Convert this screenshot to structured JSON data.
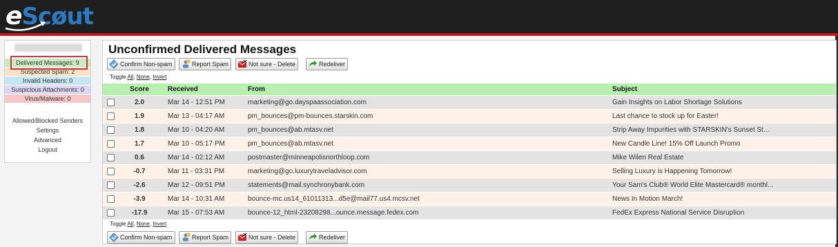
{
  "app": {
    "logo_text": "eScout"
  },
  "sidebar": {
    "folders": [
      {
        "label": "Delivered Messages: 9"
      },
      {
        "label": "Suspected Spam: 2"
      },
      {
        "label": "Invalid Headers: 0"
      },
      {
        "label": "Suspicious Attachments: 0"
      },
      {
        "label": "Virus/Malware: 0"
      }
    ],
    "links": [
      {
        "label": "Allowed/Blocked Senders"
      },
      {
        "label": "Settings"
      },
      {
        "label": "Advanced"
      },
      {
        "label": "Logout"
      }
    ]
  },
  "main": {
    "title": "Unconfirmed Delivered Messages",
    "buttons": {
      "confirm": "Confirm Non-spam",
      "report": "Report Spam",
      "delete": "Not sure - Delete",
      "redeliver": "Redeliver"
    },
    "toggle": {
      "prefix": "Toggle",
      "all": "All",
      "none": "None",
      "invert": "Invert"
    },
    "columns": {
      "score": "Score",
      "received": "Received",
      "from": "From",
      "subject": "Subject"
    },
    "rows": [
      {
        "score": "2.0",
        "received": "Mar 14 - 12:51 PM",
        "from": "marketing@go.dayspaassociation.com",
        "subject": "Gain Insights on Labor Shortage Solutions"
      },
      {
        "score": "1.9",
        "received": "Mar 13 - 04:17 AM",
        "from": "pm_bounces@pm-bounces.starskin.com",
        "subject": "Last chance to stock up for Easter!"
      },
      {
        "score": "1.8",
        "received": "Mar 10 - 04:20 AM",
        "from": "pm_bounces@ab.mtasv.net",
        "subject": "Strip Away Impurities with STARSKIN's Sunset St..."
      },
      {
        "score": "1.7",
        "received": "Mar 10 - 05:17 PM",
        "from": "pm_bounces@ab.mtasv.net",
        "subject": "New Candle Line! 15% Off Launch Promo"
      },
      {
        "score": "0.6",
        "received": "Mar 14 - 02:12 AM",
        "from": "postmaster@minneapolisnorthloop.com",
        "subject": "Mike Wilen Real Estate"
      },
      {
        "score": "-0.7",
        "received": "Mar 11 - 03:31 PM",
        "from": "marketing@go.luxurytraveladvisor.com",
        "subject": "Selling Luxury is Happening Tomorrow!"
      },
      {
        "score": "-2.6",
        "received": "Mar 12 - 09:51 PM",
        "from": "statements@mail.synchronybank.com",
        "subject": "Your Sam's Club® World Elite Mastercard® monthl..."
      },
      {
        "score": "-3.9",
        "received": "Mar 14 - 10:31 AM",
        "from": "bounce-mc.us14_61011313...d5e@mail77.us4.mcsv.net",
        "subject": "News In Motion March!"
      },
      {
        "score": "-17.9",
        "received": "Mar 15 - 07:53 AM",
        "from": "bounce-12_html-23208298...ounce.message.fedex.com",
        "subject": "FedEx Express National Service Disruption"
      }
    ]
  },
  "colors": {
    "header_bg": "#1e1e1e",
    "accent_red": "#c0161e",
    "table_header": "#b8f0b0",
    "row_grey": "#e3e3e3",
    "row_peach": "#fdf1e8",
    "highlight": "#d9304a"
  },
  "icons": {
    "confirm": "diamond-check-icon",
    "report": "person-report-icon",
    "delete": "red-envelope-x-icon",
    "redeliver": "green-arrow-icon"
  }
}
